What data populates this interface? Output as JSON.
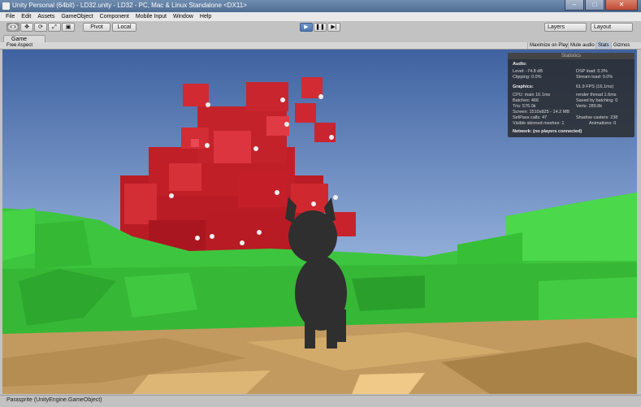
{
  "window": {
    "title": "Unity Personal (64bit) - LD32.unity - LD32 - PC, Mac & Linux Standalone <DX11>",
    "minimize": "–",
    "maximize": "□",
    "close": "✕"
  },
  "menu": [
    "File",
    "Edit",
    "Assets",
    "GameObject",
    "Component",
    "Mobile Input",
    "Window",
    "Help"
  ],
  "toolbar": {
    "pivot": "Pivot",
    "local": "Local",
    "play": "▶",
    "pause": "❚❚",
    "step": "▶|",
    "layers": "Layers",
    "layout": "Layout"
  },
  "game_tab": {
    "label": "Game",
    "aspect": "Free Aspect",
    "maximize_on_play": "Maximize on Play",
    "mute_audio": "Mute audio",
    "stats": "Stats",
    "gizmos": "Gizmos"
  },
  "statistics": {
    "title": "Statistics",
    "audio_label": "Audio:",
    "level": "Level: -74.8 dB",
    "clipping": "Clipping: 0.0%",
    "dsp_load": "DSP load: 0.3%",
    "stream_load": "Stream load: 0.0%",
    "graphics_label": "Graphics:",
    "fps": "61.9 FPS (16.1ms)",
    "cpu": "CPU: main 16.1ms",
    "render_thread": "render thread 1.6ms",
    "batches": "Batches: 466",
    "saved_batching": "Saved by batching: 0",
    "tris": "Tris: 576.0k",
    "verts": "Verts: 289.8k",
    "screen": "Screen: 1510x825 - 14.2 MB",
    "setpass": "SetPass calls: 47",
    "shadow_casters": "Shadow casters: 238",
    "skinned": "Visible skinned meshes: 1",
    "animations": "Animations: 0",
    "network": "Network: (no players connected)"
  },
  "status": {
    "text": "Parasprite (UnityEngine.GameObject)"
  },
  "colors": {
    "sky_top": "#4a6fa8",
    "sky_bottom": "#bcd0ea",
    "cube_red": "#c8202a",
    "grass_green": "#3cc63c",
    "ground_tan": "#c49a5c",
    "pony": "#2e2e2e"
  }
}
